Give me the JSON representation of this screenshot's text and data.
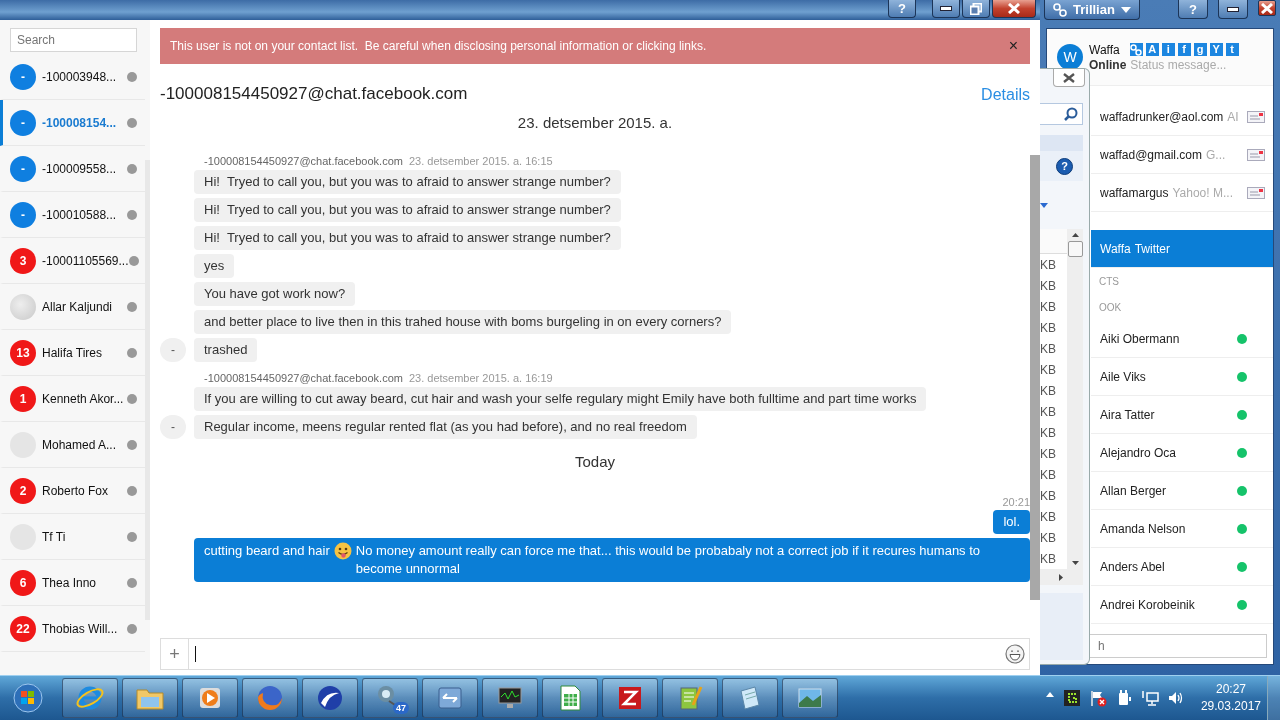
{
  "chat_window": {
    "titlebar_buttons": [
      {
        "kind": "help",
        "glyph": "?"
      },
      {
        "kind": "minimize"
      },
      {
        "kind": "maximize"
      },
      {
        "kind": "close"
      }
    ],
    "sidebar": {
      "search": {
        "placeholder": "Search"
      },
      "contacts": [
        {
          "name": "-100003948...",
          "kind": "blue",
          "badge": "-",
          "selected": false
        },
        {
          "name": "-100008154...",
          "kind": "blue",
          "badge": "-",
          "selected": true
        },
        {
          "name": "-100009558...",
          "kind": "blue",
          "badge": "-",
          "selected": false
        },
        {
          "name": "-100010588...",
          "kind": "blue",
          "badge": "-",
          "selected": false
        },
        {
          "name": "-10001105569...",
          "kind": "alert",
          "badge": "3",
          "selected": false
        },
        {
          "name": "Allar Kaljundi",
          "kind": "photo",
          "selected": false
        },
        {
          "name": "Halifa Tires",
          "kind": "alert",
          "badge": "13",
          "selected": false
        },
        {
          "name": "Kenneth Akor...",
          "kind": "alert",
          "badge": "1",
          "selected": false
        },
        {
          "name": "Mohamed A...",
          "kind": "empty",
          "selected": false
        },
        {
          "name": "Roberto Fox",
          "kind": "alert",
          "badge": "2",
          "selected": false
        },
        {
          "name": "Tf Ti",
          "kind": "empty",
          "selected": false
        },
        {
          "name": "Thea Inno",
          "kind": "alert",
          "badge": "6",
          "selected": false
        },
        {
          "name": "Thobias Will...",
          "kind": "alert",
          "badge": "22",
          "selected": false
        }
      ]
    },
    "banner": {
      "text": "This user is not on your contact list.  Be careful when disclosing personal information or clicking links.",
      "close": "×"
    },
    "header": {
      "address": "-100008154450927@chat.facebook.com",
      "details": "Details"
    },
    "messages": [
      {
        "kind": "date",
        "text": "23. detsember 2015. a."
      },
      {
        "kind": "sender",
        "name": "-100008154450927@chat.facebook.com",
        "time": "23. detsember 2015. a. 16:15"
      },
      {
        "kind": "in",
        "text": "Hi!  Tryed to call you, but you was to afraid to answer strange number?"
      },
      {
        "kind": "in",
        "text": "Hi!  Tryed to call you, but you was to afraid to answer strange number?"
      },
      {
        "kind": "in",
        "text": "Hi!  Tryed to call you, but you was to afraid to answer strange number?"
      },
      {
        "kind": "in",
        "text": "yes"
      },
      {
        "kind": "in",
        "text": "You have got work now?"
      },
      {
        "kind": "in",
        "text": "and better place to live then in this trahed house with boms burgeling in on every corners?"
      },
      {
        "kind": "in",
        "text": "trashed",
        "avatar": "-"
      },
      {
        "kind": "sender",
        "name": "-100008154450927@chat.facebook.com",
        "time": "23. detsember 2015. a. 16:19"
      },
      {
        "kind": "in",
        "text": "If you are willing to cut away beard, cut hair and wash your selfe regulary might Emily have both fulltime and part time works"
      },
      {
        "kind": "in",
        "text": "Regular income, meens regular rented flat (as you had before), and no real freedom",
        "avatar": "-"
      },
      {
        "kind": "date",
        "text": "Today"
      },
      {
        "kind": "time",
        "text": "20:21"
      },
      {
        "kind": "out",
        "text": "lol."
      },
      {
        "kind": "out",
        "text": "cutting beard and hair",
        "emoji": true,
        "text_after": "No money amount really can force me that... this would be probabaly not a correct job if it recures humans to become unnormal"
      }
    ],
    "composer": {
      "attach": "+"
    }
  },
  "file_window": {
    "help": "?",
    "rows": [
      "KB",
      "KB",
      "KB",
      "KB",
      "KB",
      "KB",
      "KB",
      "KB",
      "KB",
      "KB",
      "KB",
      "KB",
      "KB",
      "KB",
      "KB"
    ]
  },
  "trillian_window": {
    "title": "Trillian",
    "titlebar_buttons": [
      {
        "kind": "help",
        "glyph": "?"
      },
      {
        "kind": "minimize"
      },
      {
        "kind": "close"
      }
    ],
    "profile": {
      "avatar": "W",
      "name": "Waffa",
      "status": "Online",
      "status_message": "Status message...",
      "services": [
        {
          "kind": "link"
        },
        {
          "kind": "letter",
          "glyph": "A"
        },
        {
          "kind": "letter",
          "glyph": "i"
        },
        {
          "kind": "letter",
          "glyph": "f"
        },
        {
          "kind": "letter",
          "glyph": "g"
        },
        {
          "kind": "letter",
          "glyph": "Y"
        },
        {
          "kind": "letter",
          "glyph": "t"
        }
      ]
    },
    "accounts": [
      {
        "name": "waffadrunker@aol.com",
        "network": "AI",
        "selected": false
      },
      {
        "name": "waffad@gmail.com",
        "network": "G...",
        "selected": false
      },
      {
        "name": "waffamargus",
        "network": "Yahoo! M...",
        "selected": false
      },
      {
        "name": "Waffa",
        "network": "Twitter",
        "selected": true
      }
    ],
    "sections": [
      "CTS",
      "OOK"
    ],
    "contacts": [
      {
        "name": "Aiki Obermann",
        "online": true
      },
      {
        "name": "Aile Viks",
        "online": true
      },
      {
        "name": "Aira Tatter",
        "online": true
      },
      {
        "name": "Alejandro Oca",
        "online": true
      },
      {
        "name": "Allan Berger",
        "online": true
      },
      {
        "name": "Amanda Nelson",
        "online": true
      },
      {
        "name": "Anders Abel",
        "online": true
      },
      {
        "name": "Andrei Korobeinik",
        "online": true
      }
    ],
    "search": {
      "placeholder": "h"
    }
  },
  "taskbar": {
    "apps": [
      {
        "kind": "start"
      },
      {
        "kind": "browser"
      },
      {
        "kind": "folder"
      },
      {
        "kind": "media"
      },
      {
        "kind": "globe"
      },
      {
        "kind": "wave"
      },
      {
        "kind": "chat",
        "badge": "47"
      },
      {
        "kind": "archive"
      },
      {
        "kind": "monitor"
      },
      {
        "kind": "spreadsheet"
      },
      {
        "kind": "ftp"
      },
      {
        "kind": "notepadpp"
      },
      {
        "kind": "notepad"
      },
      {
        "kind": "photo"
      }
    ],
    "tray": [
      {
        "kind": "arrow"
      },
      {
        "kind": "app"
      },
      {
        "kind": "flag"
      },
      {
        "kind": "power"
      },
      {
        "kind": "network"
      },
      {
        "kind": "speaker"
      }
    ],
    "clock": {
      "time": "20:27",
      "date": "29.03.2017"
    }
  }
}
